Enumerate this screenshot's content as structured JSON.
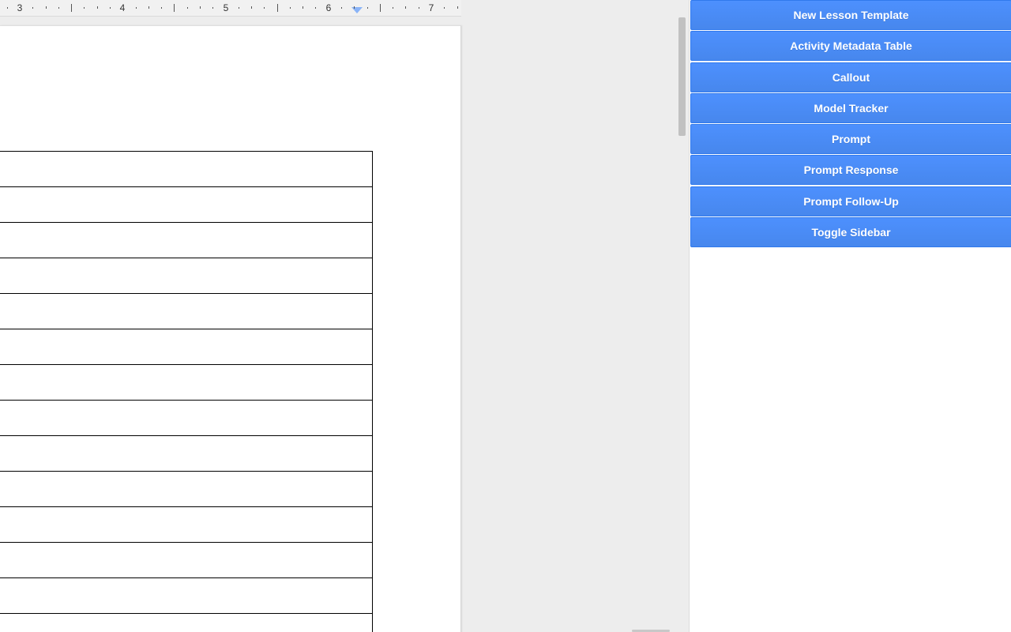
{
  "ruler": {
    "numbers": [
      {
        "label": "3"
      },
      {
        "label": "4"
      },
      {
        "label": "5"
      },
      {
        "label": "6"
      },
      {
        "label": "7"
      }
    ]
  },
  "document": {
    "table_rows": 14
  },
  "sidebar": {
    "buttons": [
      {
        "label": "New Lesson Template"
      },
      {
        "label": "Activity Metadata Table"
      },
      {
        "label": "Callout"
      },
      {
        "label": "Model Tracker"
      },
      {
        "label": "Prompt"
      },
      {
        "label": "Prompt Response"
      },
      {
        "label": "Prompt Follow-Up"
      },
      {
        "label": "Toggle Sidebar"
      }
    ]
  },
  "colors": {
    "button_blue": "#4d90fe",
    "canvas_gray": "#ededed",
    "page_white": "#ffffff",
    "indent_marker": "#8ab4f8"
  }
}
